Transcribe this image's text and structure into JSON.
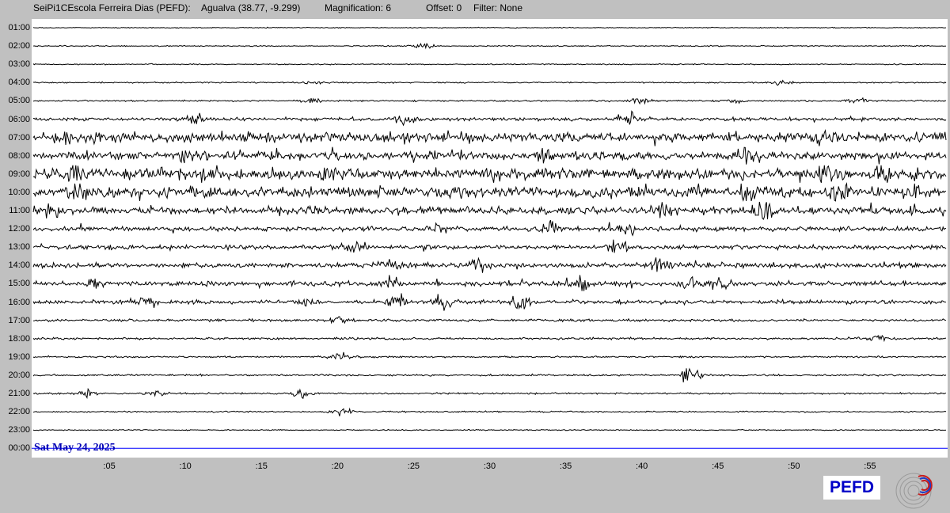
{
  "header": {
    "station": "SeiPi1CEscola Ferreira Dias (PEFD):",
    "location": "Agualva (38.77, -9.299)",
    "magnification": "Magnification: 6",
    "offset": "Offset: 0",
    "filter": "Filter: None"
  },
  "date_label": "Sat May 24, 2025",
  "logo_text": "PEFD",
  "colors": {
    "background": "#c0c0c0",
    "trace": "#000000",
    "date_label": "#0000b4",
    "current_line": "#0000ff",
    "logo_text": "#0000c8"
  },
  "chart_data": {
    "type": "line",
    "subtype": "helicorder",
    "hours": [
      "01:00",
      "02:00",
      "03:00",
      "04:00",
      "05:00",
      "06:00",
      "07:00",
      "08:00",
      "09:00",
      "10:00",
      "11:00",
      "12:00",
      "13:00",
      "14:00",
      "15:00",
      "16:00",
      "17:00",
      "18:00",
      "19:00",
      "20:00",
      "21:00",
      "22:00",
      "23:00",
      "00:00"
    ],
    "minute_ticks": [
      ":05",
      ":10",
      ":15",
      ":20",
      ":25",
      ":30",
      ":35",
      ":40",
      ":45",
      ":50",
      ":55"
    ],
    "minute_tick_values": [
      5,
      10,
      15,
      20,
      25,
      30,
      35,
      40,
      45,
      50,
      55
    ],
    "xlim": [
      0,
      60
    ],
    "row_noise_level": [
      0.5,
      0.6,
      0.6,
      0.7,
      0.9,
      1.8,
      5.5,
      4.8,
      6.2,
      5.8,
      4.2,
      2.6,
      2.4,
      2.8,
      2.6,
      2.2,
      1.4,
      1.2,
      1.0,
      1.0,
      0.9,
      0.8,
      0.6,
      0
    ],
    "row_bursts": [
      [],
      [
        [
          25.7,
          6
        ]
      ],
      [],
      [
        [
          18.5,
          3
        ],
        [
          49.2,
          3
        ]
      ],
      [
        [
          18.3,
          3
        ],
        [
          40,
          4
        ],
        [
          46,
          3
        ],
        [
          54,
          4
        ]
      ],
      [
        [
          10.5,
          6
        ],
        [
          24.3,
          7
        ],
        [
          39.2,
          8
        ]
      ],
      [
        [
          2,
          8
        ],
        [
          52,
          9
        ]
      ],
      [
        [
          10,
          6
        ],
        [
          33.5,
          6
        ],
        [
          47,
          9
        ]
      ],
      [
        [
          3,
          9
        ],
        [
          19.5,
          8
        ],
        [
          52,
          11
        ],
        [
          56,
          9
        ]
      ],
      [
        [
          3,
          8
        ],
        [
          47,
          9
        ],
        [
          53,
          10
        ],
        [
          58,
          8
        ]
      ],
      [
        [
          1,
          7
        ],
        [
          41.5,
          10
        ],
        [
          48,
          9
        ]
      ],
      [
        [
          26.5,
          6
        ],
        [
          34,
          9
        ],
        [
          39,
          6
        ]
      ],
      [
        [
          21,
          6
        ],
        [
          38.5,
          7
        ]
      ],
      [
        [
          23.5,
          8
        ],
        [
          29,
          7
        ],
        [
          41,
          8
        ]
      ],
      [
        [
          4,
          7
        ],
        [
          23.5,
          8
        ],
        [
          36,
          9
        ],
        [
          43,
          7
        ],
        [
          45,
          8
        ]
      ],
      [
        [
          7.5,
          7
        ],
        [
          18,
          6
        ],
        [
          24,
          9
        ],
        [
          27,
          10
        ],
        [
          32,
          9
        ]
      ],
      [
        [
          20,
          5
        ]
      ],
      [
        [
          55.5,
          5
        ]
      ],
      [
        [
          20.2,
          7
        ]
      ],
      [
        [
          43.2,
          12
        ]
      ],
      [
        [
          3.5,
          5
        ],
        [
          8,
          6
        ],
        [
          17.5,
          5
        ]
      ],
      [
        [
          20.3,
          5
        ]
      ],
      [],
      []
    ]
  }
}
